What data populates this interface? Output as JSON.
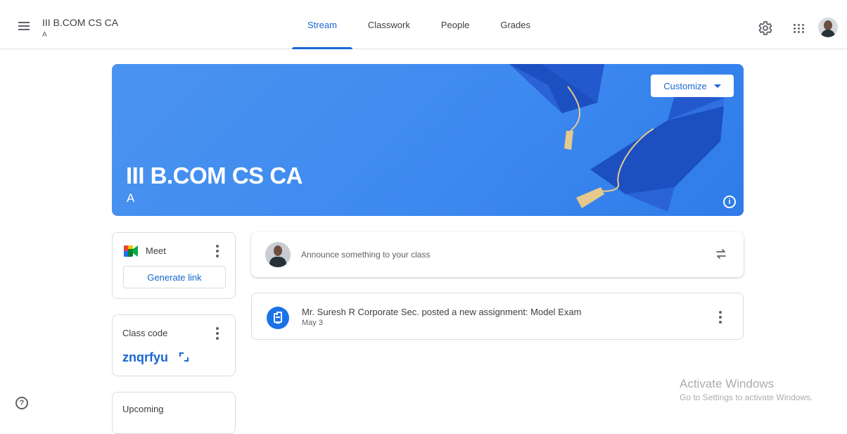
{
  "header": {
    "class_title": "III B.COM CS CA",
    "class_section": "A",
    "tabs": [
      {
        "label": "Stream",
        "active": true
      },
      {
        "label": "Classwork",
        "active": false
      },
      {
        "label": "People",
        "active": false
      },
      {
        "label": "Grades",
        "active": false
      }
    ],
    "icons": [
      "menu-icon",
      "gear-icon",
      "apps-grid-icon",
      "profile-avatar"
    ]
  },
  "banner": {
    "title": "III B.COM CS CA",
    "section": "A",
    "customize_label": "Customize",
    "info_icon": "info-icon",
    "background_color": "#3d8af0"
  },
  "sidebar": {
    "meet": {
      "label": "Meet",
      "button_label": "Generate link"
    },
    "class_code": {
      "label": "Class code",
      "value": "znqrfyu"
    },
    "upcoming": {
      "label": "Upcoming"
    }
  },
  "stream": {
    "announce_placeholder": "Announce something to your class",
    "posts": [
      {
        "title": "Mr. Suresh R Corporate Sec. posted a new assignment: Model Exam",
        "date": "May 3",
        "icon": "assignment-icon"
      }
    ]
  },
  "footer": {
    "help_icon": "?",
    "watermark_title": "Activate Windows",
    "watermark_sub": "Go to Settings to activate Windows."
  },
  "colors": {
    "accent": "#1967d2",
    "banner": "#3d8af0"
  }
}
